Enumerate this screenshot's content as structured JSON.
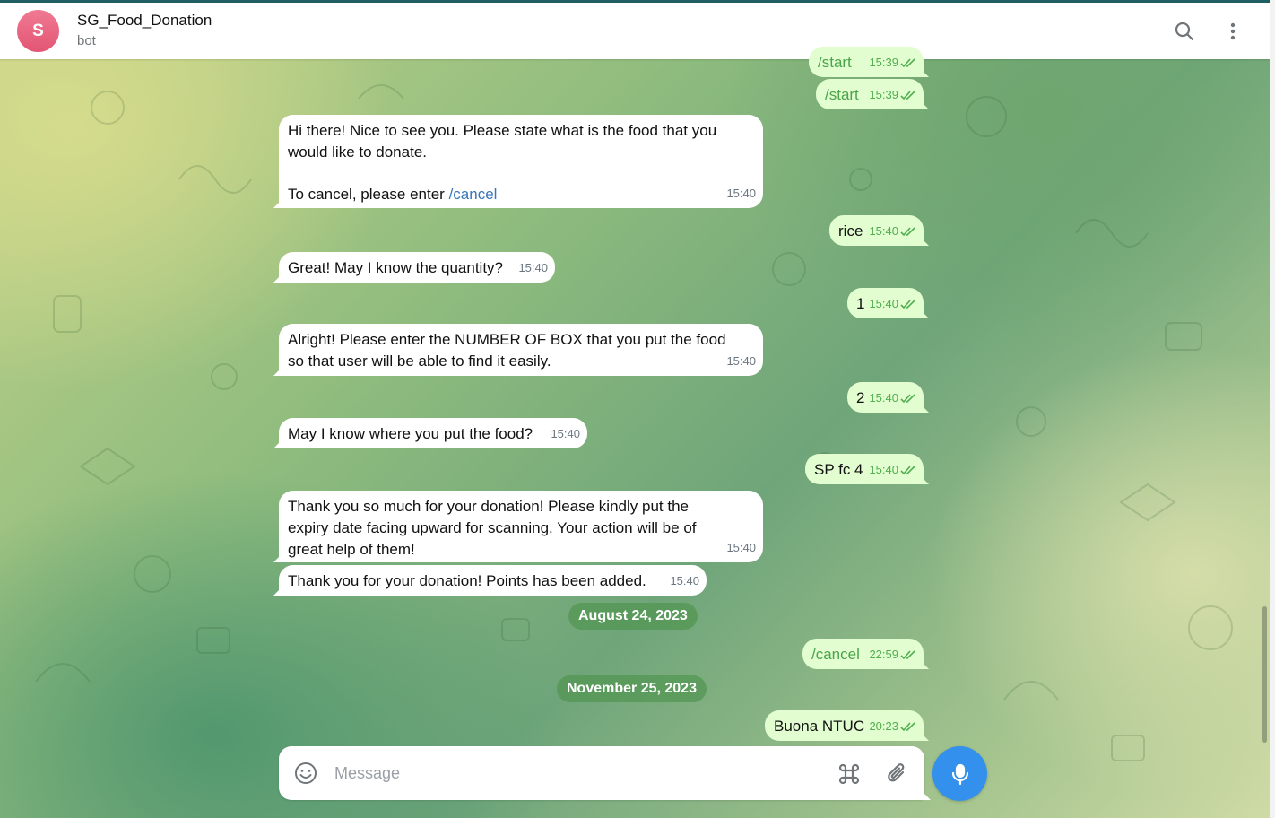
{
  "header": {
    "avatar_letter": "S",
    "title": "SG_Food_Donation",
    "subtitle": "bot",
    "search_icon": "search-icon",
    "menu_icon": "more-vertical-icon"
  },
  "colors": {
    "header_bg": "#ffffff",
    "accent": "#3390ec",
    "outgoing_bubble": "#e2fdd0",
    "incoming_bubble": "#ffffff",
    "link": "#3a76b9",
    "avatar": "#e8607d"
  },
  "messages": [
    {
      "dir": "out",
      "text": "/start",
      "time": "15:39",
      "status": "read"
    },
    {
      "dir": "out",
      "text": "/start",
      "time": "15:39",
      "status": "read"
    },
    {
      "dir": "in",
      "line1": "Hi there! Nice to see you. Please state what is the food that you",
      "line2": "would like to donate.",
      "line3": "To cancel, please enter ",
      "link": "/cancel",
      "time": "15:40"
    },
    {
      "dir": "out",
      "text": "rice",
      "time": "15:40",
      "status": "read"
    },
    {
      "dir": "in",
      "text": "Great! May I know the quantity?",
      "time": "15:40"
    },
    {
      "dir": "out",
      "text": "1",
      "time": "15:40",
      "status": "read"
    },
    {
      "dir": "in",
      "line1": "Alright! Please enter the NUMBER OF BOX that you put the food",
      "line2": "so that user will be able to find it easily.",
      "time": "15:40"
    },
    {
      "dir": "out",
      "text": "2",
      "time": "15:40",
      "status": "read"
    },
    {
      "dir": "in",
      "text": "May I know where you put the food?",
      "time": "15:40"
    },
    {
      "dir": "out",
      "text": "SP fc 4",
      "time": "15:40",
      "status": "read"
    },
    {
      "dir": "in",
      "line1": "Thank you so much for your donation! Please kindly put the",
      "line2": "expiry date facing upward for scanning. Your action will be of",
      "line3": "great help of them!",
      "time": "15:40"
    },
    {
      "dir": "in",
      "text": "Thank you for your donation! Points has been added.",
      "time": "15:40"
    },
    {
      "dir": "out",
      "text": "/cancel",
      "time": "22:59",
      "status": "read"
    },
    {
      "dir": "out",
      "text": "Buona NTUC",
      "time": "20:23",
      "status": "read"
    }
  ],
  "dates": [
    "August 24, 2023",
    "November 25, 2023"
  ],
  "composer": {
    "placeholder": "Message",
    "emoji_icon": "emoji-icon",
    "command_icon": "command-icon",
    "attach_icon": "paperclip-icon",
    "mic_icon": "microphone-icon"
  }
}
